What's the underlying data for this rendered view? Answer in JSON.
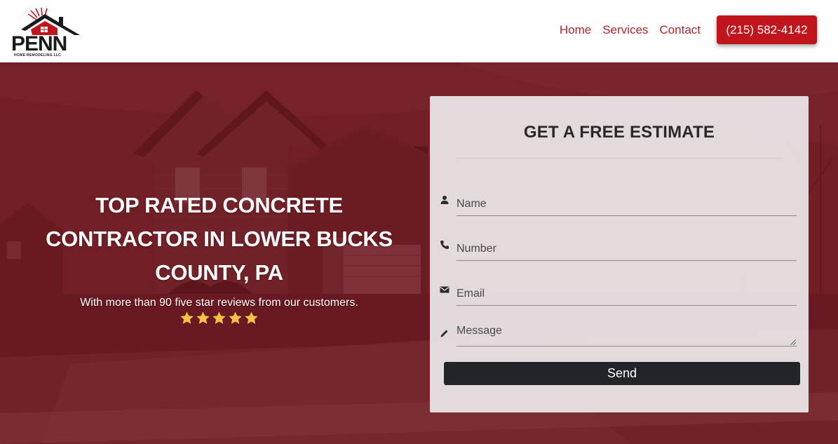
{
  "header": {
    "logo": {
      "word": "PENN",
      "tagline": "HOME REMODELING LLC"
    },
    "nav": [
      {
        "label": "Home"
      },
      {
        "label": "Services"
      },
      {
        "label": "Contact"
      }
    ],
    "phone": "(215) 582-4142"
  },
  "hero": {
    "title": "TOP RATED CONCRETE CONTRACTOR IN LOWER BUCKS COUNTY, PA",
    "subtitle": "With more than 90 five star reviews from our customers.",
    "rating": 5
  },
  "form": {
    "title": "GET A FREE ESTIMATE",
    "fields": {
      "name": {
        "placeholder": "Name",
        "icon": "user-icon"
      },
      "number": {
        "placeholder": "Number",
        "icon": "phone-icon"
      },
      "email": {
        "placeholder": "Email",
        "icon": "envelope-icon"
      },
      "message": {
        "placeholder": "Message",
        "icon": "pencil-icon"
      }
    },
    "submit_label": "Send"
  },
  "colors": {
    "brand_red": "#c0151c",
    "nav_text": "#b3242b",
    "hero_overlay": "#761a22",
    "send_button": "#212529",
    "star": "#f5c242"
  }
}
